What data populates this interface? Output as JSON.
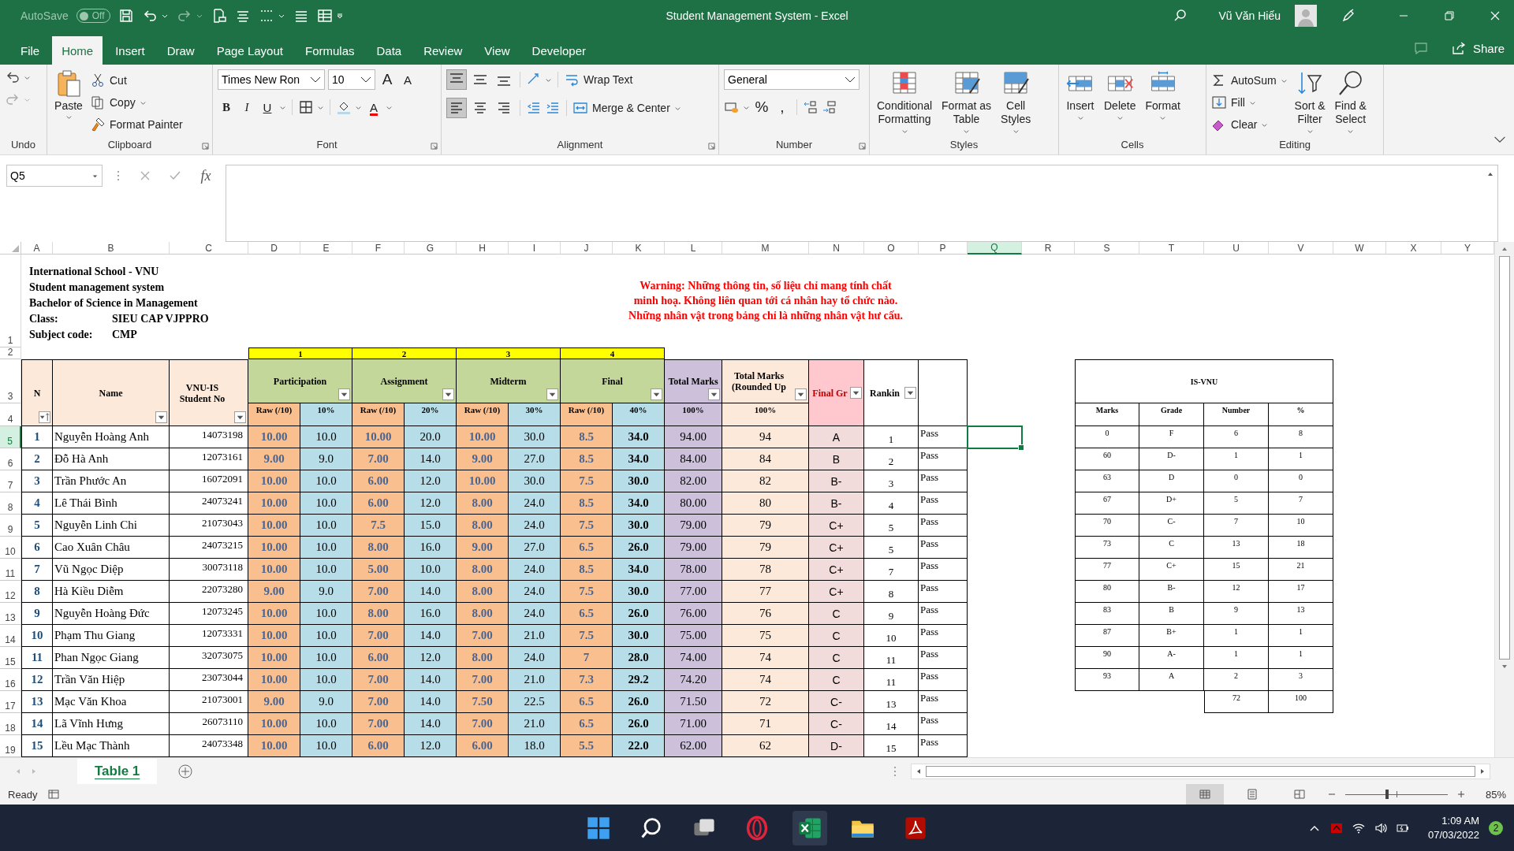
{
  "window": {
    "autosave_label": "AutoSave",
    "autosave": {
      "on": false,
      "label": "Off"
    },
    "title": "Student Management System  -  Excel",
    "user": "Vũ Văn Hiếu"
  },
  "menu_tabs": [
    {
      "label": "File",
      "selected": false
    },
    {
      "label": "Home",
      "selected": true
    },
    {
      "label": "Insert",
      "selected": false
    },
    {
      "label": "Draw",
      "selected": false
    },
    {
      "label": "Page Layout",
      "selected": false
    },
    {
      "label": "Formulas",
      "selected": false
    },
    {
      "label": "Data",
      "selected": false
    },
    {
      "label": "Review",
      "selected": false
    },
    {
      "label": "View",
      "selected": false
    },
    {
      "label": "Developer",
      "selected": false
    }
  ],
  "share": "Share",
  "ribbon": {
    "undo": {
      "title": "Undo"
    },
    "clipboard": {
      "title": "Clipboard",
      "paste": "Paste",
      "cut": "Cut",
      "copy": "Copy",
      "format_painter": "Format Painter"
    },
    "font": {
      "title": "Font",
      "family": "Times New Ron",
      "size": "10",
      "grow": "A",
      "shrink": "A",
      "bold": "B",
      "italic": "I",
      "underline": "U",
      "font_color": "A"
    },
    "alignment": {
      "title": "Alignment",
      "vertical": [
        {
          "selected": true
        },
        {
          "selected": false
        },
        {
          "selected": false
        }
      ],
      "horizontal": [
        {
          "selected": true
        },
        {
          "selected": false
        },
        {
          "selected": false
        }
      ],
      "wrap_text": "Wrap Text",
      "merge_center": "Merge & Center"
    },
    "number": {
      "title": "Number",
      "format": "General",
      "percent": "%",
      "comma": ","
    },
    "styles": {
      "title": "Styles",
      "buttons": [
        {
          "kind": "conditional",
          "lines": [
            "Conditional",
            "Formatting"
          ]
        },
        {
          "kind": "table",
          "lines": [
            "Format as",
            "Table"
          ]
        },
        {
          "kind": "cell",
          "lines": [
            "Cell",
            "Styles"
          ]
        }
      ]
    },
    "cells": {
      "title": "Cells",
      "buttons": [
        {
          "kind": "insert",
          "lines": [
            "Insert"
          ]
        },
        {
          "kind": "delete",
          "lines": [
            "Delete"
          ]
        },
        {
          "kind": "format",
          "lines": [
            "Format"
          ]
        }
      ]
    },
    "editing": {
      "title": "Editing",
      "autosum": "AutoSum",
      "fill": "Fill",
      "clear": "Clear",
      "sort_filter": [
        "Sort &",
        "Filter"
      ],
      "find_select": [
        "Find &",
        "Select"
      ]
    }
  },
  "formula_bar": {
    "name_box": "Q5",
    "fx": "fx"
  },
  "sheet": {
    "columns": [
      {
        "label": "A",
        "selected": false
      },
      {
        "label": "B",
        "selected": false
      },
      {
        "label": "C",
        "selected": false
      },
      {
        "label": "D",
        "selected": false
      },
      {
        "label": "E",
        "selected": false
      },
      {
        "label": "F",
        "selected": false
      },
      {
        "label": "G",
        "selected": false
      },
      {
        "label": "H",
        "selected": false
      },
      {
        "label": "I",
        "selected": false
      },
      {
        "label": "J",
        "selected": false
      },
      {
        "label": "K",
        "selected": false
      },
      {
        "label": "L",
        "selected": false
      },
      {
        "label": "M",
        "selected": false
      },
      {
        "label": "N",
        "selected": false
      },
      {
        "label": "O",
        "selected": false
      },
      {
        "label": "P",
        "selected": false
      },
      {
        "label": "Q",
        "selected": true
      },
      {
        "label": "R",
        "selected": false
      },
      {
        "label": "S",
        "selected": false
      },
      {
        "label": "T",
        "selected": false
      },
      {
        "label": "U",
        "selected": false
      },
      {
        "label": "V",
        "selected": false
      },
      {
        "label": "W",
        "selected": false
      },
      {
        "label": "X",
        "selected": false
      },
      {
        "label": "Y",
        "selected": false
      }
    ],
    "row_headers": [
      {
        "label": "1",
        "selected": false
      },
      {
        "label": "2",
        "selected": false
      },
      {
        "label": "3",
        "selected": false
      },
      {
        "label": "4",
        "selected": false
      },
      {
        "label": "5",
        "selected": true
      },
      {
        "label": "6",
        "selected": false
      },
      {
        "label": "7",
        "selected": false
      },
      {
        "label": "8",
        "selected": false
      },
      {
        "label": "9",
        "selected": false
      },
      {
        "label": "10",
        "selected": false
      },
      {
        "label": "11",
        "selected": false
      },
      {
        "label": "12",
        "selected": false
      },
      {
        "label": "13",
        "selected": false
      },
      {
        "label": "14",
        "selected": false
      },
      {
        "label": "15",
        "selected": false
      },
      {
        "label": "16",
        "selected": false
      },
      {
        "label": "17",
        "selected": false
      },
      {
        "label": "18",
        "selected": false
      },
      {
        "label": "19",
        "selected": false
      }
    ],
    "info": [
      {
        "label": "International School - VNU"
      },
      {
        "label": "Student management system"
      },
      {
        "label": "Bachelor of Science in Management"
      },
      {
        "label": "Class:",
        "value": "SIEU CAP VJPPRO"
      },
      {
        "label": "Subject code:",
        "value": "CMP"
      }
    ],
    "warning": [
      "Warning: Những thông tin, số liệu chỉ mang tính chất",
      "minh hoạ. Không liên quan tới cá nhân hay tổ chức nào.",
      "Những nhân vật trong bảng chỉ là những nhân vật hư cấu."
    ],
    "components": [
      {
        "number": "1",
        "name": "Participation",
        "raw": "Raw (/10)",
        "weight": "10%"
      },
      {
        "number": "2",
        "name": "Assignment",
        "raw": "Raw (/10)",
        "weight": "20%"
      },
      {
        "number": "3",
        "name": "Midterm",
        "raw": "Raw (/10)",
        "weight": "30%"
      },
      {
        "number": "4",
        "name": "Final",
        "raw": "Raw (/10)",
        "weight": "40%"
      }
    ],
    "headers": {
      "no": "N",
      "name": "Name",
      "student_no": "VNU-IS Student No",
      "total": "Total Marks",
      "total_pct": "100%",
      "rounded": "Total Marks (Rounded Up",
      "rounded_pct": "100%",
      "final_grade": "Final Gr",
      "ranking": "Rankin"
    },
    "students": [
      {
        "no": "1",
        "name": "Nguyễn Hoàng Anh",
        "id": "14073198",
        "scores": [
          [
            "10.00",
            "10.0"
          ],
          [
            "10.00",
            "20.0"
          ],
          [
            "10.00",
            "30.0"
          ],
          [
            "8.5",
            "34.0"
          ]
        ],
        "total": "94.00",
        "rounded": "94",
        "grade": "A",
        "rank": "1",
        "result": "Pass"
      },
      {
        "no": "2",
        "name": "Đỗ Hà Anh",
        "id": "12073161",
        "scores": [
          [
            "9.00",
            "9.0"
          ],
          [
            "7.00",
            "14.0"
          ],
          [
            "9.00",
            "27.0"
          ],
          [
            "8.5",
            "34.0"
          ]
        ],
        "total": "84.00",
        "rounded": "84",
        "grade": "B",
        "rank": "2",
        "result": "Pass"
      },
      {
        "no": "3",
        "name": "Trần Phước An",
        "id": "16072091",
        "scores": [
          [
            "10.00",
            "10.0"
          ],
          [
            "6.00",
            "12.0"
          ],
          [
            "10.00",
            "30.0"
          ],
          [
            "7.5",
            "30.0"
          ]
        ],
        "total": "82.00",
        "rounded": "82",
        "grade": "B-",
        "rank": "3",
        "result": "Pass"
      },
      {
        "no": "4",
        "name": "Lê Thái Bình",
        "id": "24073241",
        "scores": [
          [
            "10.00",
            "10.0"
          ],
          [
            "6.00",
            "12.0"
          ],
          [
            "8.00",
            "24.0"
          ],
          [
            "8.5",
            "34.0"
          ]
        ],
        "total": "80.00",
        "rounded": "80",
        "grade": "B-",
        "rank": "4",
        "result": "Pass"
      },
      {
        "no": "5",
        "name": "Nguyễn Linh Chi",
        "id": "21073043",
        "scores": [
          [
            "10.00",
            "10.0"
          ],
          [
            "7.5",
            "15.0"
          ],
          [
            "8.00",
            "24.0"
          ],
          [
            "7.5",
            "30.0"
          ]
        ],
        "total": "79.00",
        "rounded": "79",
        "grade": "C+",
        "rank": "5",
        "result": "Pass"
      },
      {
        "no": "6",
        "name": "Cao Xuân Châu",
        "id": "24073215",
        "scores": [
          [
            "10.00",
            "10.0"
          ],
          [
            "8.00",
            "16.0"
          ],
          [
            "9.00",
            "27.0"
          ],
          [
            "6.5",
            "26.0"
          ]
        ],
        "total": "79.00",
        "rounded": "79",
        "grade": "C+",
        "rank": "5",
        "result": "Pass"
      },
      {
        "no": "7",
        "name": "Vũ Ngọc Diệp",
        "id": "30073118",
        "scores": [
          [
            "10.00",
            "10.0"
          ],
          [
            "5.00",
            "10.0"
          ],
          [
            "8.00",
            "24.0"
          ],
          [
            "8.5",
            "34.0"
          ]
        ],
        "total": "78.00",
        "rounded": "78",
        "grade": "C+",
        "rank": "7",
        "result": "Pass"
      },
      {
        "no": "8",
        "name": "Hà Kiều Diễm",
        "id": "22073280",
        "scores": [
          [
            "9.00",
            "9.0"
          ],
          [
            "7.00",
            "14.0"
          ],
          [
            "8.00",
            "24.0"
          ],
          [
            "7.5",
            "30.0"
          ]
        ],
        "total": "77.00",
        "rounded": "77",
        "grade": "C+",
        "rank": "8",
        "result": "Pass"
      },
      {
        "no": "9",
        "name": "Nguyễn Hoàng Đức",
        "id": "12073245",
        "scores": [
          [
            "10.00",
            "10.0"
          ],
          [
            "8.00",
            "16.0"
          ],
          [
            "8.00",
            "24.0"
          ],
          [
            "6.5",
            "26.0"
          ]
        ],
        "total": "76.00",
        "rounded": "76",
        "grade": "C",
        "rank": "9",
        "result": "Pass"
      },
      {
        "no": "10",
        "name": "Phạm Thu Giang",
        "id": "12073331",
        "scores": [
          [
            "10.00",
            "10.0"
          ],
          [
            "7.00",
            "14.0"
          ],
          [
            "7.00",
            "21.0"
          ],
          [
            "7.5",
            "30.0"
          ]
        ],
        "total": "75.00",
        "rounded": "75",
        "grade": "C",
        "rank": "10",
        "result": "Pass"
      },
      {
        "no": "11",
        "name": "Phan Ngọc Giang",
        "id": "32073075",
        "scores": [
          [
            "10.00",
            "10.0"
          ],
          [
            "6.00",
            "12.0"
          ],
          [
            "8.00",
            "24.0"
          ],
          [
            "7",
            "28.0"
          ]
        ],
        "total": "74.00",
        "rounded": "74",
        "grade": "C",
        "rank": "11",
        "result": "Pass"
      },
      {
        "no": "12",
        "name": "Trần Văn Hiệp",
        "id": "23073044",
        "scores": [
          [
            "10.00",
            "10.0"
          ],
          [
            "7.00",
            "14.0"
          ],
          [
            "7.00",
            "21.0"
          ],
          [
            "7.3",
            "29.2"
          ]
        ],
        "total": "74.20",
        "rounded": "74",
        "grade": "C",
        "rank": "11",
        "result": "Pass"
      },
      {
        "no": "13",
        "name": "Mạc Văn Khoa",
        "id": "21073001",
        "scores": [
          [
            "9.00",
            "9.0"
          ],
          [
            "7.00",
            "14.0"
          ],
          [
            "7.50",
            "22.5"
          ],
          [
            "6.5",
            "26.0"
          ]
        ],
        "total": "71.50",
        "rounded": "72",
        "grade": "C-",
        "rank": "13",
        "result": "Pass"
      },
      {
        "no": "14",
        "name": "Lã Vĩnh Hưng",
        "id": "26073110",
        "scores": [
          [
            "10.00",
            "10.0"
          ],
          [
            "7.00",
            "14.0"
          ],
          [
            "7.00",
            "21.0"
          ],
          [
            "6.5",
            "26.0"
          ]
        ],
        "total": "71.00",
        "rounded": "71",
        "grade": "C-",
        "rank": "14",
        "result": "Pass"
      },
      {
        "no": "15",
        "name": "Lều Mạc Thành",
        "id": "24073348",
        "scores": [
          [
            "10.00",
            "10.0"
          ],
          [
            "6.00",
            "12.0"
          ],
          [
            "6.00",
            "18.0"
          ],
          [
            "5.5",
            "22.0"
          ]
        ],
        "total": "62.00",
        "rounded": "62",
        "grade": "D-",
        "rank": "15",
        "result": "Pass"
      }
    ]
  },
  "grade_table": {
    "title": "IS-VNU",
    "columns": [
      "Marks",
      "Grade",
      "Number",
      "%"
    ],
    "rows": [
      [
        "0",
        "F",
        "6",
        "8"
      ],
      [
        "60",
        "D-",
        "1",
        "1"
      ],
      [
        "63",
        "D",
        "0",
        "0"
      ],
      [
        "67",
        "D+",
        "5",
        "7"
      ],
      [
        "70",
        "C-",
        "7",
        "10"
      ],
      [
        "73",
        "C",
        "13",
        "18"
      ],
      [
        "77",
        "C+",
        "15",
        "21"
      ],
      [
        "80",
        "B-",
        "12",
        "17"
      ],
      [
        "83",
        "B",
        "9",
        "13"
      ],
      [
        "87",
        "B+",
        "1",
        "1"
      ],
      [
        "90",
        "A-",
        "1",
        "1"
      ],
      [
        "93",
        "A",
        "2",
        "3"
      ]
    ],
    "totals": [
      "72",
      "100"
    ]
  },
  "sheet_tabs": [
    {
      "label": "Table 1",
      "selected": true
    }
  ],
  "status_bar": {
    "text": "Ready",
    "views": [
      {
        "selected": true
      },
      {
        "selected": false
      },
      {
        "selected": false
      }
    ],
    "zoom_slider": {
      "level": 0.41
    },
    "zoom": "85%"
  },
  "taskbar": {
    "time": "1:09 AM",
    "date": "07/03/2022",
    "notifications": "2"
  }
}
